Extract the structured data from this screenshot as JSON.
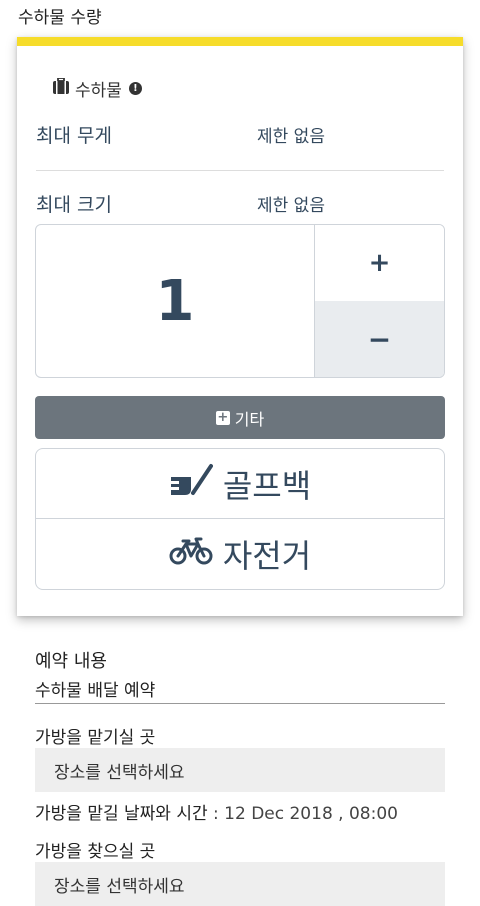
{
  "header": {
    "title": "수하물 수량"
  },
  "category": {
    "name": "수하물"
  },
  "specs": {
    "max_weight_label": "최대 무게",
    "max_weight_value": "제한 없음",
    "max_size_label": "최대 크기",
    "max_size_value": "제한 없음"
  },
  "quantity": {
    "value": "1",
    "plus_label": "+",
    "minus_label": "−"
  },
  "etc_button": {
    "label": "기타"
  },
  "options": [
    {
      "label": "골프백",
      "icon": "golf-bag-icon"
    },
    {
      "label": "자전거",
      "icon": "bicycle-icon"
    }
  ],
  "reservation": {
    "title": "예약 내용",
    "subtitle": "수하물 배달 예약",
    "dropoff_label": "가방을 맡기실 곳",
    "dropoff_placeholder": "장소를 선택하세요",
    "datetime_label": "가방을 맡길 날짜와 시간",
    "datetime_value": " : 12 Dec 2018 , 08:00",
    "pickup_label": "가방을 찾으실 곳",
    "pickup_placeholder": "장소를 선택하세요"
  },
  "colors": {
    "accent": "#f6dc2a",
    "text": "#34495e",
    "button": "#6c757d"
  }
}
